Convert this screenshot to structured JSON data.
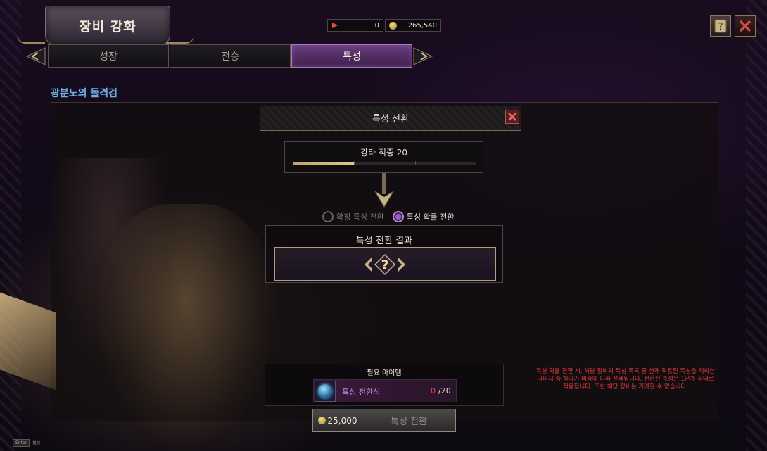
{
  "window": {
    "title": "장비 강화"
  },
  "currency": {
    "red_value": "0",
    "gold_value": "265,540"
  },
  "tabs": [
    {
      "label": "성장"
    },
    {
      "label": "전승"
    },
    {
      "label": "특성"
    }
  ],
  "item": {
    "name": "광분노의 돌격검"
  },
  "dialog": {
    "title": "특성 전환",
    "current_stat": "강타 적중 20",
    "stat_progress": 0.34,
    "radio_options": [
      {
        "label": "확정 특성 전환",
        "selected": false
      },
      {
        "label": "특성 확률 전환",
        "selected": true
      }
    ],
    "result_title": "특성 전환 결과",
    "result_placeholder": "?"
  },
  "required": {
    "title": "필요 아이템",
    "item_name": "특성 전환석",
    "have": "0",
    "need": "/20"
  },
  "action": {
    "cost": "25,000",
    "label": "특성 전환"
  },
  "note": "특성 확률 전환 시, 해당 장비의 특성 목록 중 현재 적용된 특성을 제외한 나머지 중 하나가 비중에 따라 선택됩니다. 전환된 특성은 1단계 상태로 적용됩니다. 또한 해당 장비는 거래할 수 없습니다.",
  "footer": {
    "key": "Enter",
    "hint": "채팅"
  },
  "colors": {
    "accent": "#9b59d0",
    "warning": "#e23a3a",
    "item_name": "#6fb1e7"
  },
  "icons": [
    "flag-icon",
    "gold-coin-icon",
    "help-book-icon",
    "close-icon",
    "chevron-left-icon",
    "chevron-right-icon",
    "down-arrow-icon",
    "question-icon",
    "gem-icon"
  ]
}
